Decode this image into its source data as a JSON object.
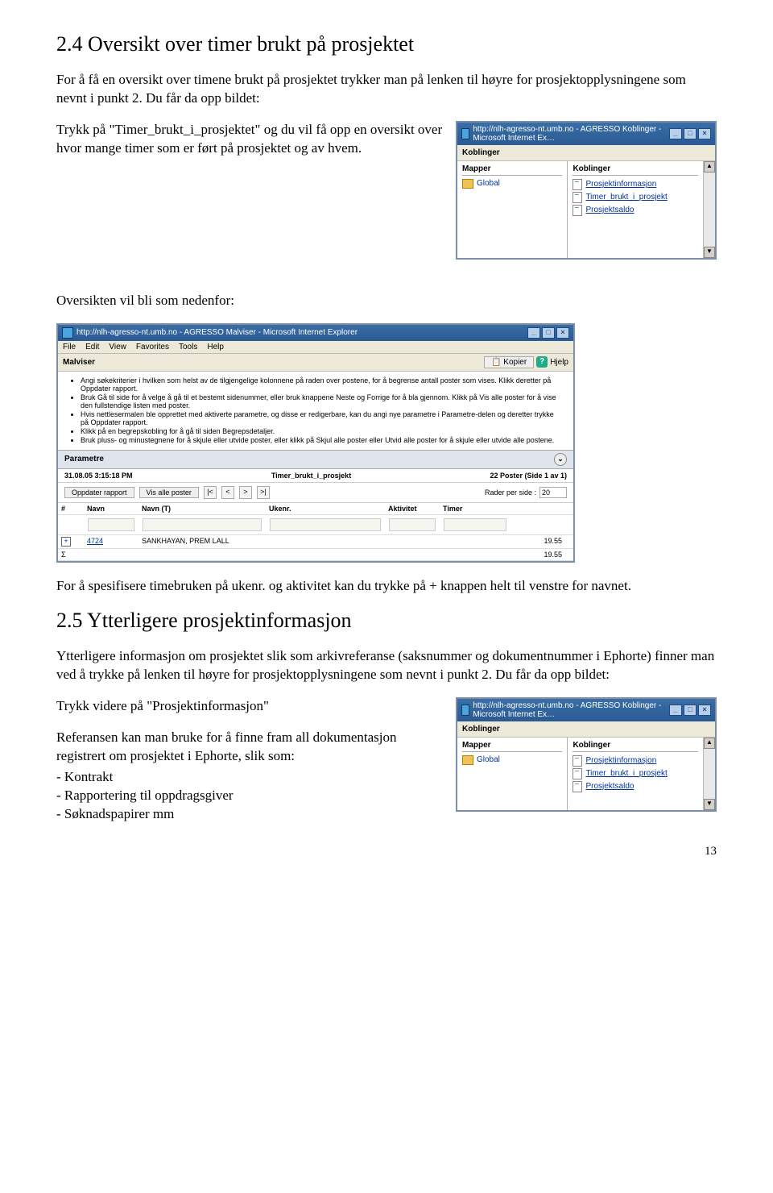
{
  "section1": {
    "heading": "2.4  Oversikt over timer brukt på prosjektet",
    "para1": "For å få en oversikt over timene brukt på prosjektet trykker man på lenken til høyre for prosjektopplysningene som nevnt i punkt 2. Du får da opp bildet:",
    "para2": "Trykk på \"Timer_brukt_i_prosjektet\" og du vil få opp en oversikt over hvor mange timer som er ført på prosjektet og av hvem.",
    "para3": "Oversikten vil bli som nedenfor:",
    "para4": "For å spesifisere timebruken på ukenr. og aktivitet kan du trykke på + knappen helt til venstre for navnet."
  },
  "section2": {
    "heading": "2.5  Ytterligere prosjektinformasjon",
    "para1": "Ytterligere informasjon om prosjektet slik som arkivreferanse (saksnummer og dokumentnummer i Ephorte) finner man ved å trykke på lenken til høyre for prosjektopplysningene som nevnt i punkt 2. Du får da opp bildet:",
    "para2": "Trykk videre på \"Prosjektinformasjon\"",
    "para3": "Referansen kan man bruke for å finne fram all dokumentasjon registrert om prosjektet i Ephorte, slik som:",
    "list": [
      "- Kontrakt",
      "- Rapportering til oppdragsgiver",
      "- Søknadspapirer mm"
    ]
  },
  "koblinger": {
    "title": "http://nlh-agresso-nt.umb.no - AGRESSO Koblinger - Microsoft Internet Ex…",
    "header": "Koblinger",
    "col_left": "Mapper",
    "col_right": "Koblinger",
    "folder": "Global",
    "links": [
      "Prosjektinformasjon",
      "Timer_brukt_i_prosjekt",
      "Prosjektsaldo"
    ]
  },
  "malviser": {
    "title": "http://nlh-agresso-nt.umb.no - AGRESSO Malviser - Microsoft Internet Explorer",
    "menus": [
      "File",
      "Edit",
      "View",
      "Favorites",
      "Tools",
      "Help"
    ],
    "tab": "Malviser",
    "btn_kopier": "Kopier",
    "btn_hjelp": "Hjelp",
    "bullets": [
      "Angi søkekriterier i hvilken som helst av de tilgjengelige kolonnene på raden over postene, for å begrense antall poster som vises. Klikk deretter på Oppdater rapport.",
      "Bruk Gå til side for å velge å gå til et bestemt sidenummer, eller bruk knappene Neste og Forrige for å bla gjennom. Klikk på Vis alle poster for å vise den fullstendige listen med poster.",
      "Hvis nettlesermalen ble opprettet med aktiverte parametre, og disse er redigerbare, kan du angi nye parametre i Parametre-delen og deretter trykke på Oppdater rapport.",
      "Klikk på en begrepskobling for å gå til siden Begrepsdetaljer.",
      "Bruk pluss- og minustegnene for å skjule eller utvide poster, eller klikk på Skjul alle poster eller Utvid alle poster for å skjule eller utvide alle postene."
    ],
    "param_label": "Parametre",
    "status_left": "31.08.05 3:15:18 PM",
    "status_mid": "Timer_brukt_i_prosjekt",
    "status_right": "22 Poster (Side 1 av 1)",
    "btn_update": "Oppdater rapport",
    "btn_all": "Vis alle poster",
    "rows_label": "Rader per side :",
    "rows_value": "20",
    "cols": [
      "#",
      "Navn",
      "Navn (T)",
      "Ukenr.",
      "Aktivitet",
      "Timer"
    ],
    "row": {
      "id": "4724",
      "name": "SANKHAYAN, PREM LALL",
      "hours": "19.55"
    },
    "sum_hours": "19.55"
  },
  "page_number": "13"
}
